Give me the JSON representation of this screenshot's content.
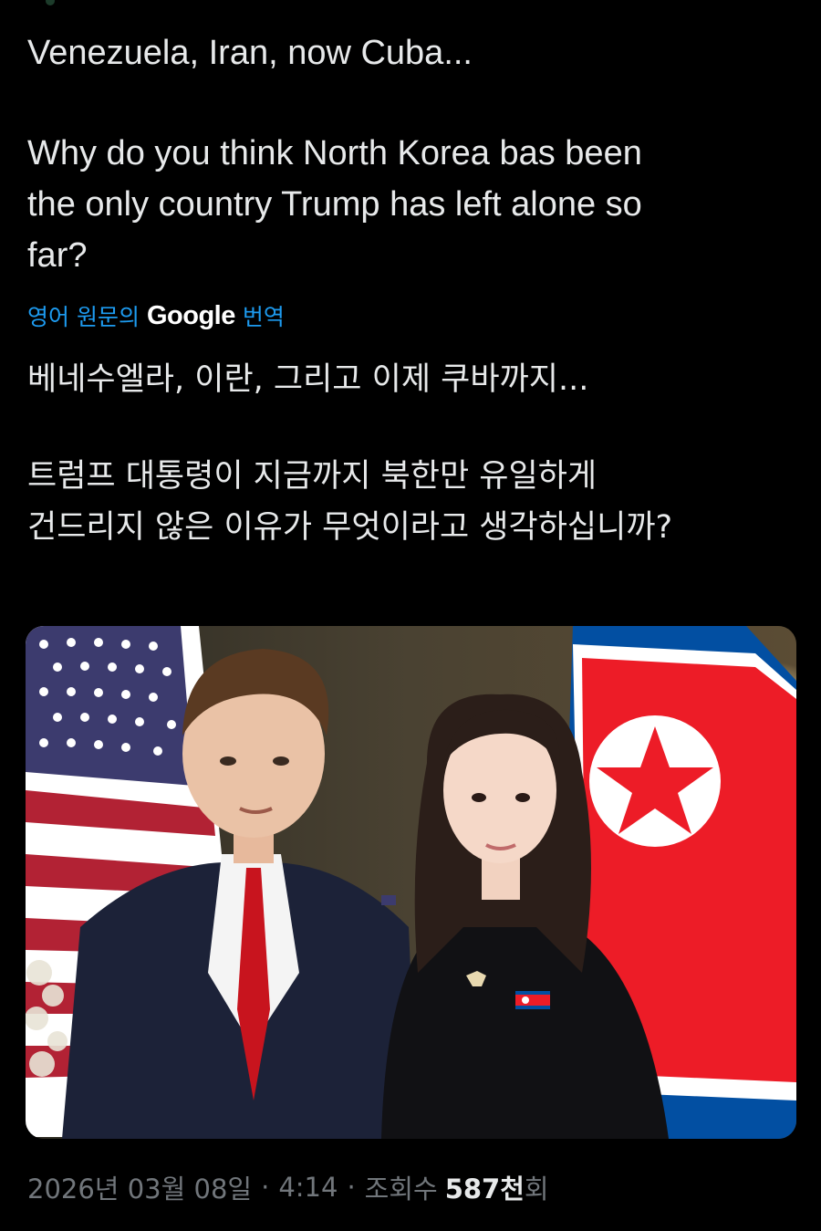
{
  "tweet": {
    "text_lines_1": [
      "Venezuela, Iran, now Cuba..."
    ],
    "text_lines_2": [
      "Why do you think North Korea bas been",
      "the only country Trump has left alone so",
      "far?"
    ]
  },
  "translate": {
    "prefix": "영어 원문의",
    "brand": "Google",
    "suffix": "번역"
  },
  "translation": {
    "line1": "베네수엘라, 이란, 그리고 이제 쿠바까지...",
    "line2": "트럼프 대통령이 지금까지 북한만 유일하게",
    "line3": "건드리지 않은 이유가 무엇이라고 생각하십니까?"
  },
  "meta": {
    "date": "2026년 03월 08일",
    "time": "4:14",
    "views_label": "조회수",
    "views_count": "587천",
    "views_suffix": "회"
  },
  "media": {
    "description_icon": "photo-image",
    "colors": {
      "us_red": "#b22234",
      "us_blue": "#3c3b6e",
      "nk_blue": "#024fa2",
      "nk_red": "#ed1c27"
    }
  }
}
